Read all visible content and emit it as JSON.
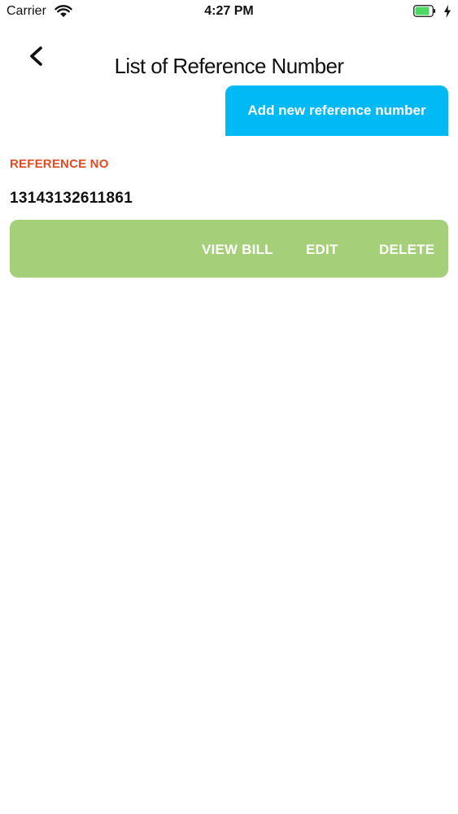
{
  "status_bar": {
    "carrier": "Carrier",
    "time": "4:27 PM",
    "icons": [
      "wifi-icon",
      "battery-icon",
      "charging-bolt-icon"
    ],
    "battery_color": "#4cd964"
  },
  "header": {
    "title": "List of Reference Number",
    "back_icon": "chevron-left-icon"
  },
  "add_button": {
    "label": "Add new reference number",
    "color": "#00b9f5"
  },
  "references": {
    "label": "REFERENCE NO",
    "label_color": "#e24b23",
    "items": [
      {
        "number": "13143132611861",
        "actions": {
          "view": "VIEW BILL",
          "edit": "EDIT",
          "delete": "DELETE"
        },
        "bar_color": "#a5cf78"
      }
    ]
  }
}
